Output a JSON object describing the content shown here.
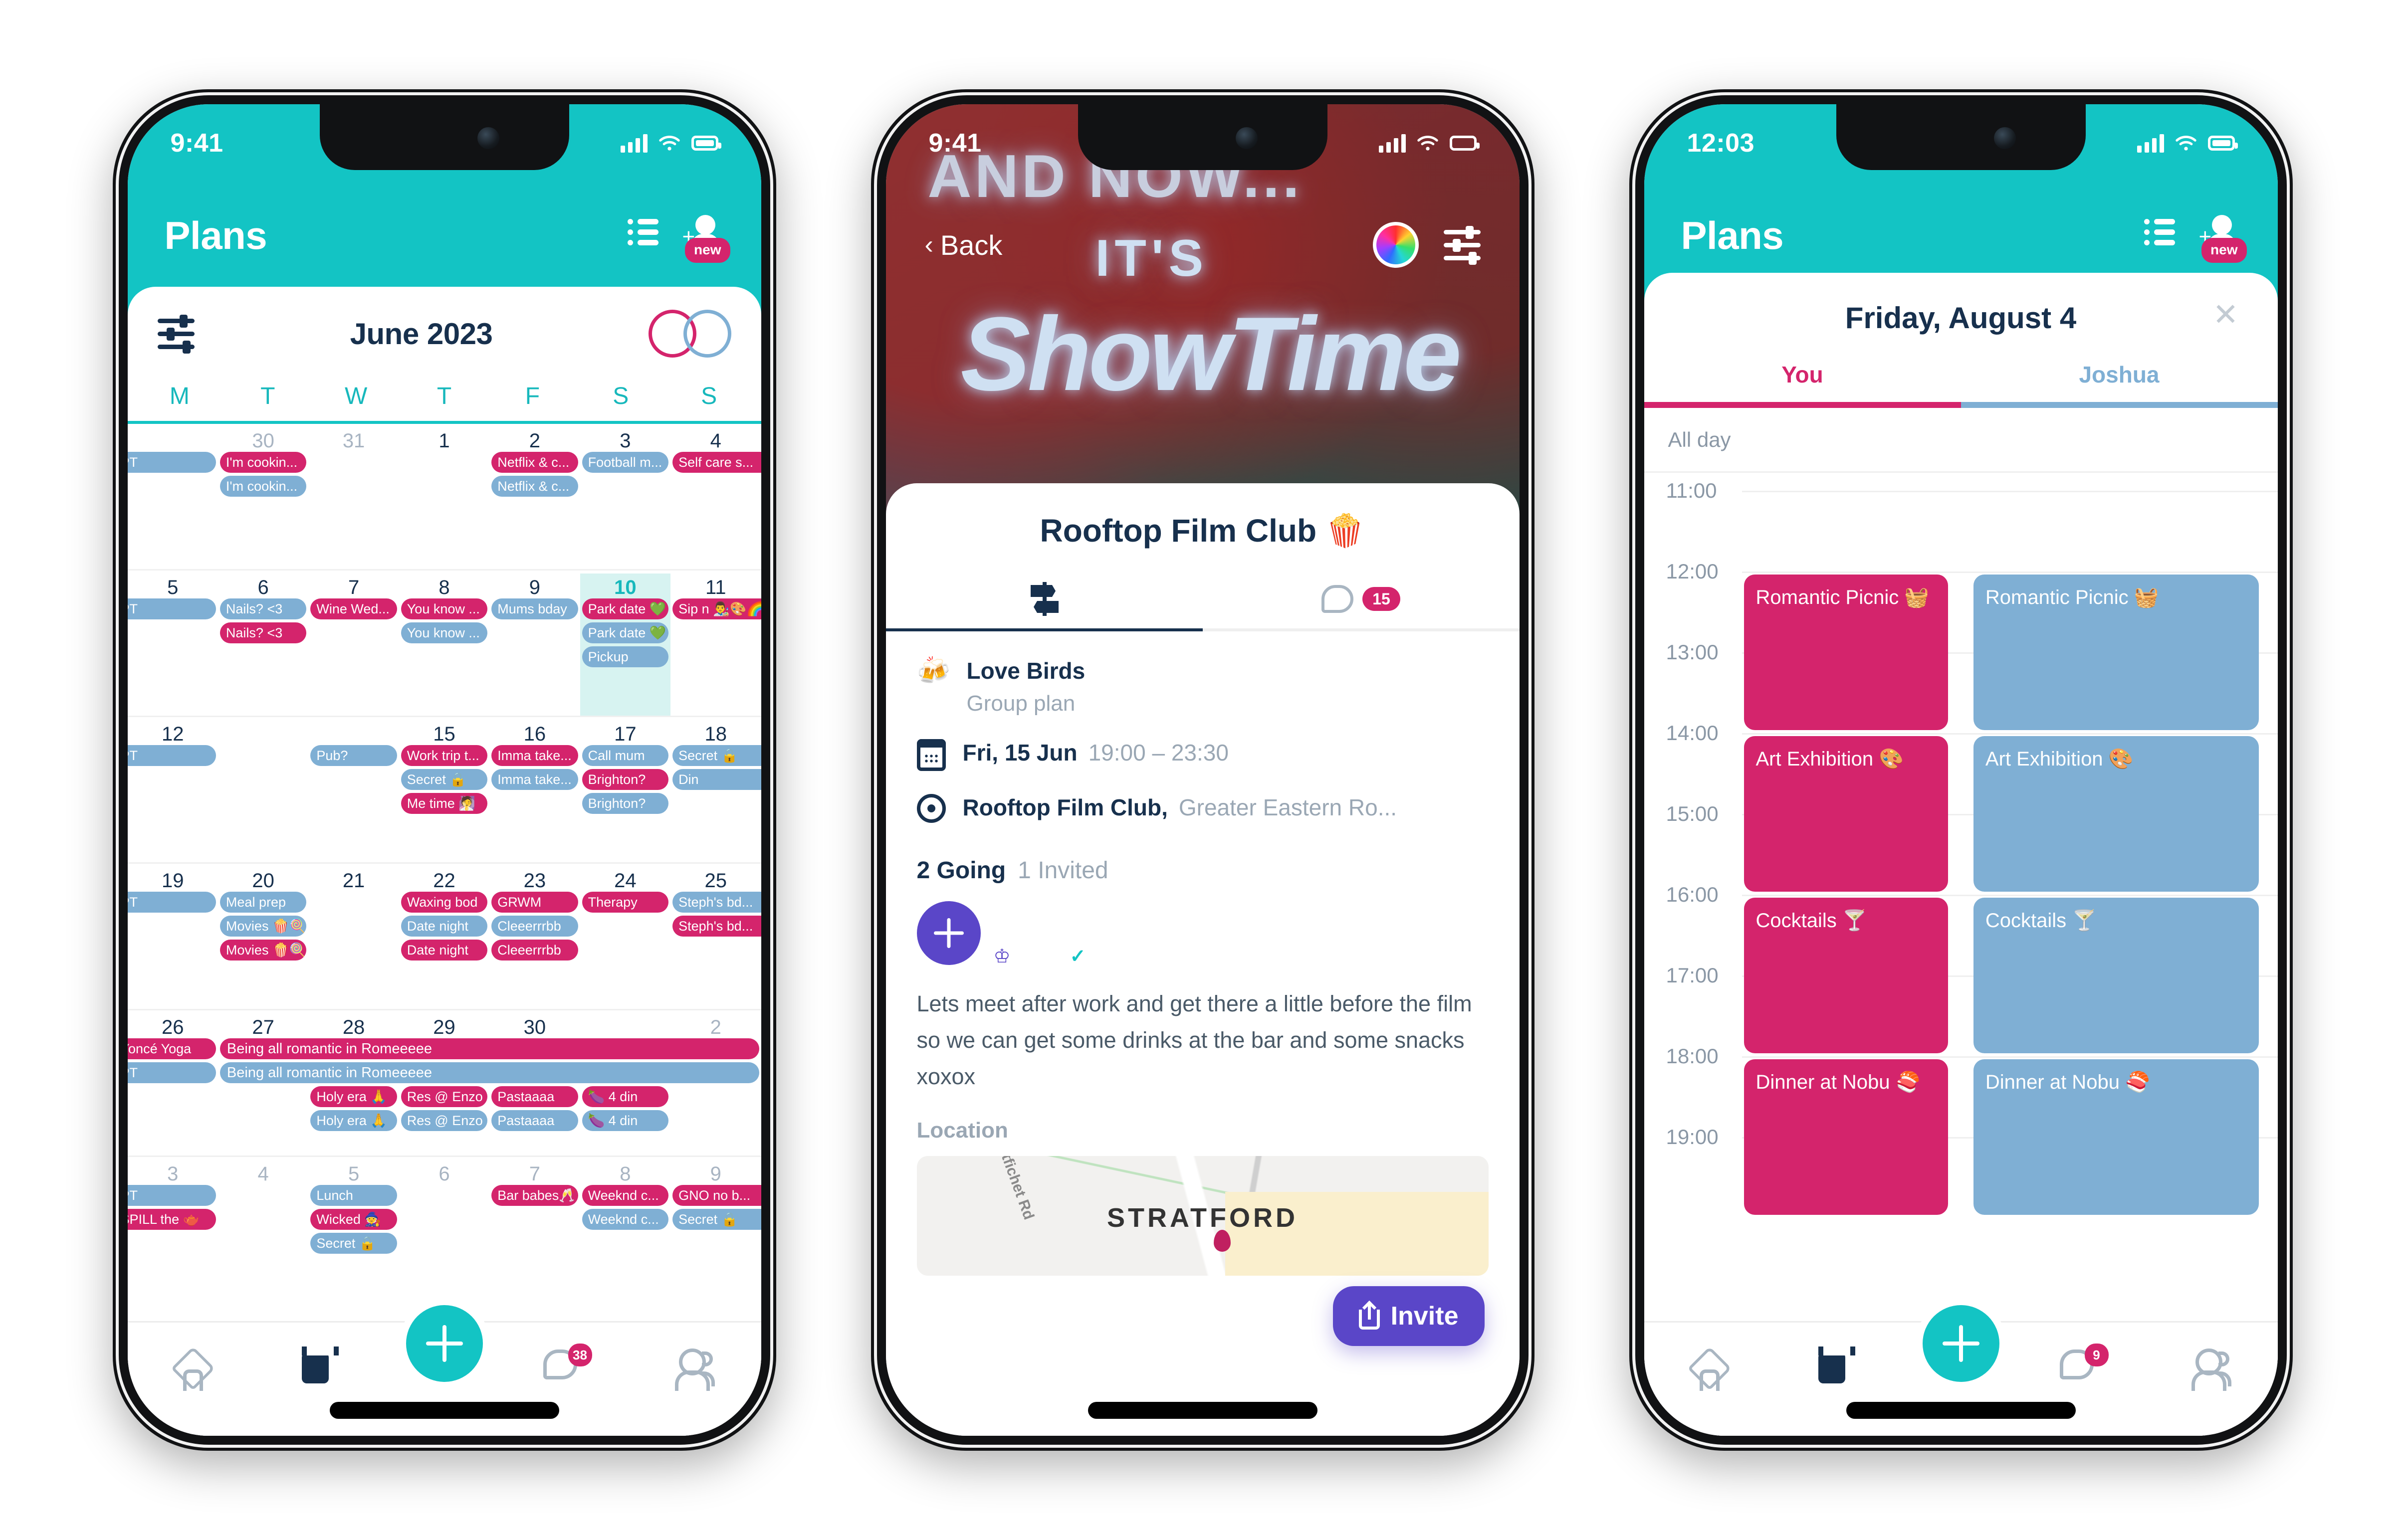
{
  "phone1": {
    "status": {
      "time": "9:41",
      "signal_icon": "cellular-bars-icon",
      "wifi_icon": "wifi-icon",
      "battery_icon": "battery-icon"
    },
    "header": {
      "title": "Plans",
      "list_icon": "list-view-icon",
      "add_user_icon": "add-user-icon",
      "new_badge": "new"
    },
    "calendar": {
      "filter_icon": "filter-sliders-icon",
      "month": "June 2023",
      "avatar1": "avatar-user-pink",
      "avatar2": "avatar-user-blue",
      "dow": [
        "M",
        "T",
        "W",
        "T",
        "F",
        "S",
        "S"
      ],
      "weeks": [
        {
          "days": [
            {
              "num": "",
              "dim": false
            },
            {
              "num": "30",
              "dim": true
            },
            {
              "num": "31",
              "dim": true
            },
            {
              "num": "1",
              "dim": false
            },
            {
              "num": "2",
              "dim": false
            },
            {
              "num": "3",
              "dim": false
            },
            {
              "num": "4",
              "dim": false
            }
          ],
          "chips": [
            {
              "col": 0,
              "row": 0,
              "color": "blue",
              "label": "PT",
              "bleedL": true
            },
            {
              "col": 1,
              "row": 0,
              "color": "pink",
              "label": "I'm cookin..."
            },
            {
              "col": 1,
              "row": 1,
              "color": "blue",
              "label": "I'm cookin..."
            },
            {
              "col": 4,
              "row": 0,
              "color": "pink",
              "label": "Netflix & c..."
            },
            {
              "col": 4,
              "row": 1,
              "color": "blue",
              "label": "Netflix & c..."
            },
            {
              "col": 5,
              "row": 0,
              "color": "blue",
              "label": "Football m..."
            },
            {
              "col": 6,
              "row": 0,
              "color": "pink",
              "label": "Self care s...",
              "bleedR": true
            }
          ]
        },
        {
          "days": [
            {
              "num": "5",
              "dim": false
            },
            {
              "num": "6",
              "dim": false
            },
            {
              "num": "7",
              "dim": false
            },
            {
              "num": "8",
              "dim": false
            },
            {
              "num": "9",
              "dim": false
            },
            {
              "num": "10",
              "dim": false,
              "today": true
            },
            {
              "num": "11",
              "dim": false
            }
          ],
          "chips": [
            {
              "col": 0,
              "row": 0,
              "color": "blue",
              "label": "PT",
              "bleedL": true
            },
            {
              "col": 1,
              "row": 0,
              "color": "blue",
              "label": "Nails? <3"
            },
            {
              "col": 1,
              "row": 1,
              "color": "pink",
              "label": "Nails? <3"
            },
            {
              "col": 2,
              "row": 0,
              "color": "pink",
              "label": "Wine Wed..."
            },
            {
              "col": 3,
              "row": 0,
              "color": "pink",
              "label": "You know ..."
            },
            {
              "col": 3,
              "row": 1,
              "color": "blue",
              "label": "You know ..."
            },
            {
              "col": 4,
              "row": 0,
              "color": "blue",
              "label": "Mums bday"
            },
            {
              "col": 5,
              "row": 0,
              "color": "pink",
              "label": "Park date 💚"
            },
            {
              "col": 5,
              "row": 1,
              "color": "blue",
              "label": "Park date 💚"
            },
            {
              "col": 5,
              "row": 2,
              "color": "blue",
              "label": "Pickup"
            },
            {
              "col": 6,
              "row": 0,
              "color": "pink",
              "label": "Sip n 👨‍🎨🎨🌈",
              "bleedR": true
            }
          ]
        },
        {
          "days": [
            {
              "num": "12",
              "dim": false
            },
            {
              "num": "",
              "dim": false
            },
            {
              "num": "",
              "dim": false
            },
            {
              "num": "15",
              "dim": false
            },
            {
              "num": "16",
              "dim": false
            },
            {
              "num": "17",
              "dim": false
            },
            {
              "num": "18",
              "dim": false
            }
          ],
          "chips": [
            {
              "col": 0,
              "row": 0,
              "color": "blue",
              "label": "PT",
              "bleedL": true
            },
            {
              "col": 2,
              "row": 0,
              "color": "blue",
              "label": "Pub?"
            },
            {
              "col": 3,
              "row": 0,
              "color": "pink",
              "label": "Work trip t..."
            },
            {
              "col": 3,
              "row": 1,
              "color": "blue",
              "label": "Secret 🔒"
            },
            {
              "col": 3,
              "row": 2,
              "color": "pink",
              "label": "Me time 🧖"
            },
            {
              "col": 4,
              "row": 0,
              "color": "pink",
              "label": "Imma take..."
            },
            {
              "col": 4,
              "row": 1,
              "color": "blue",
              "label": "Imma take..."
            },
            {
              "col": 5,
              "row": 0,
              "color": "blue",
              "label": "Call mum"
            },
            {
              "col": 5,
              "row": 1,
              "color": "pink",
              "label": "Brighton?"
            },
            {
              "col": 5,
              "row": 2,
              "color": "blue",
              "label": "Brighton?"
            },
            {
              "col": 6,
              "row": 0,
              "color": "blue",
              "label": "Secret 🔒",
              "bleedR": true
            },
            {
              "col": 6,
              "row": 1,
              "color": "blue",
              "label": "Din",
              "bleedR": true
            }
          ]
        },
        {
          "days": [
            {
              "num": "19",
              "dim": false
            },
            {
              "num": "20",
              "dim": false
            },
            {
              "num": "21",
              "dim": false
            },
            {
              "num": "22",
              "dim": false
            },
            {
              "num": "23",
              "dim": false
            },
            {
              "num": "24",
              "dim": false
            },
            {
              "num": "25",
              "dim": false
            }
          ],
          "chips": [
            {
              "col": 0,
              "row": 0,
              "color": "blue",
              "label": "PT",
              "bleedL": true
            },
            {
              "col": 1,
              "row": 0,
              "color": "blue",
              "label": "Meal prep"
            },
            {
              "col": 1,
              "row": 1,
              "color": "blue",
              "label": "Movies 🍿🍭"
            },
            {
              "col": 1,
              "row": 2,
              "color": "pink",
              "label": "Movies 🍿🍭"
            },
            {
              "col": 3,
              "row": 0,
              "color": "pink",
              "label": "Waxing bod"
            },
            {
              "col": 3,
              "row": 1,
              "color": "blue",
              "label": "Date night"
            },
            {
              "col": 3,
              "row": 2,
              "color": "pink",
              "label": "Date night"
            },
            {
              "col": 4,
              "row": 0,
              "color": "pink",
              "label": "GRWM"
            },
            {
              "col": 4,
              "row": 1,
              "color": "blue",
              "label": "Cleeerrrbb"
            },
            {
              "col": 4,
              "row": 2,
              "color": "pink",
              "label": "Cleeerrrbb"
            },
            {
              "col": 5,
              "row": 0,
              "color": "pink",
              "label": "Therapy"
            },
            {
              "col": 6,
              "row": 0,
              "color": "blue",
              "label": "Steph's bd...",
              "bleedR": true
            },
            {
              "col": 6,
              "row": 1,
              "color": "pink",
              "label": "Steph's bd...",
              "bleedR": true
            }
          ]
        },
        {
          "days": [
            {
              "num": "26",
              "dim": false
            },
            {
              "num": "27",
              "dim": false
            },
            {
              "num": "28",
              "dim": false
            },
            {
              "num": "29",
              "dim": false
            },
            {
              "num": "30",
              "dim": false
            },
            {
              "num": "",
              "dim": true
            },
            {
              "num": "2",
              "dim": true
            }
          ],
          "chips": [
            {
              "col": 0,
              "row": 0,
              "color": "pink",
              "label": "Yoncé Yoga",
              "bleedL": true
            },
            {
              "col": 0,
              "row": 1,
              "color": "blue",
              "label": "PT",
              "bleedL": true
            },
            {
              "col": 2,
              "row": 2,
              "color": "pink",
              "label": "Holy era 🙏"
            },
            {
              "col": 2,
              "row": 3,
              "color": "blue",
              "label": "Holy era 🙏"
            },
            {
              "col": 3,
              "row": 2,
              "color": "pink",
              "label": "Res @ Enzo"
            },
            {
              "col": 3,
              "row": 3,
              "color": "blue",
              "label": "Res @ Enzo"
            },
            {
              "col": 4,
              "row": 2,
              "color": "pink",
              "label": "Pastaaaa"
            },
            {
              "col": 4,
              "row": 3,
              "color": "blue",
              "label": "Pastaaaa"
            },
            {
              "col": 5,
              "row": 2,
              "color": "pink",
              "label": "🍆 4 din"
            },
            {
              "col": 5,
              "row": 3,
              "color": "blue",
              "label": "🍆 4 din"
            }
          ],
          "spans": [
            {
              "start": 1,
              "end": 6,
              "row": 0,
              "color": "pink",
              "label": "Being all romantic in Romeeeee"
            },
            {
              "start": 1,
              "end": 6,
              "row": 1,
              "color": "blue",
              "label": "Being all romantic in Romeeeee"
            }
          ]
        },
        {
          "days": [
            {
              "num": "3",
              "dim": true
            },
            {
              "num": "4",
              "dim": true
            },
            {
              "num": "5",
              "dim": true
            },
            {
              "num": "6",
              "dim": true
            },
            {
              "num": "7",
              "dim": true
            },
            {
              "num": "8",
              "dim": true
            },
            {
              "num": "9",
              "dim": true
            }
          ],
          "chips": [
            {
              "col": 0,
              "row": 0,
              "color": "blue",
              "label": "PT",
              "bleedL": true
            },
            {
              "col": 0,
              "row": 1,
              "color": "pink",
              "label": "SPILL the 🫖",
              "bleedL": true
            },
            {
              "col": 2,
              "row": 0,
              "color": "blue",
              "label": "Lunch"
            },
            {
              "col": 2,
              "row": 1,
              "color": "pink",
              "label": "Wicked 🧙"
            },
            {
              "col": 2,
              "row": 2,
              "color": "blue",
              "label": "Secret 🔒"
            },
            {
              "col": 4,
              "row": 0,
              "color": "pink",
              "label": "Bar babes🥂"
            },
            {
              "col": 5,
              "row": 0,
              "color": "pink",
              "label": "Weeknd c..."
            },
            {
              "col": 5,
              "row": 1,
              "color": "blue",
              "label": "Weeknd c..."
            },
            {
              "col": 6,
              "row": 0,
              "color": "pink",
              "label": "GNO no b...",
              "bleedR": true
            },
            {
              "col": 6,
              "row": 1,
              "color": "blue",
              "label": "Secret 🔒",
              "bleedR": true
            }
          ]
        }
      ]
    },
    "nav": {
      "home_icon": "home-icon",
      "calendar_icon": "calendar-icon",
      "add_icon": "plus-icon",
      "chat_icon": "chat-icon",
      "chat_badge": "38",
      "people_icon": "people-icon"
    }
  },
  "phone2": {
    "status": {
      "time": "9:41"
    },
    "hero": {
      "sign_line1": "AND NOW...",
      "sign_line2": "IT'S",
      "sign_line3": "ShowTime",
      "back_label": "Back",
      "color_wheel_icon": "color-wheel-icon",
      "settings_icon": "settings-sliders-icon"
    },
    "sheet": {
      "title": "Rooftop Film Club 🍿",
      "tab_details_icon": "signpost-icon",
      "tab_chat_icon": "chat-bubble-icon",
      "chat_count": "15",
      "group": {
        "emoji": "🍻",
        "name": "Love Birds",
        "subtitle": "Group plan"
      },
      "date": {
        "icon": "calendar-icon",
        "day": "Fri, 15 Jun",
        "time": "19:00 – 23:30"
      },
      "place": {
        "icon": "location-pin-icon",
        "venue": "Rooftop Film Club,",
        "address": "Greater Eastern Ro..."
      },
      "going_label": "2 Going",
      "invited_label": "1 Invited",
      "add_person_icon": "plus-icon",
      "avatar_host": "avatar-host",
      "avatar_guest": "avatar-guest",
      "host_marker": "♔",
      "guest_marker": "✓",
      "description": "Lets meet after work and get there a little before the film so we can get some drinks at the bar and some snacks xoxox",
      "location_label": "Location",
      "map_road": "ntfichet Rd",
      "map_town": "STRATFORD",
      "map_pin_icon": "map-pin-icon",
      "invite_label": "Invite",
      "invite_icon": "share-icon"
    }
  },
  "phone3": {
    "status": {
      "time": "12:03"
    },
    "header": {
      "title": "Plans",
      "list_icon": "list-view-icon",
      "add_user_icon": "add-user-icon",
      "new_badge": "new"
    },
    "day": {
      "title": "Friday, August 4",
      "close_icon": "close-icon",
      "tab_you": "You",
      "tab_other": "Joshua",
      "all_day_label": "All day",
      "hours": [
        "11:00",
        "12:00",
        "13:00",
        "14:00",
        "15:00",
        "16:00",
        "17:00",
        "18:00",
        "19:00"
      ],
      "events_you": [
        {
          "label": "Romantic Picnic 🧺",
          "start": 12.0,
          "end": 14.0
        },
        {
          "label": "Art Exhibition 🎨",
          "start": 14.0,
          "end": 16.0
        },
        {
          "label": "Cocktails 🍸",
          "start": 16.0,
          "end": 18.0
        },
        {
          "label": "Dinner at Nobu 🍣",
          "start": 18.0,
          "end": 20.0
        }
      ],
      "events_other": [
        {
          "label": "Romantic Picnic 🧺",
          "start": 12.0,
          "end": 14.0
        },
        {
          "label": "Art Exhibition 🎨",
          "start": 14.0,
          "end": 16.0
        },
        {
          "label": "Cocktails 🍸",
          "start": 16.0,
          "end": 18.0
        },
        {
          "label": "Dinner at Nobu 🍣",
          "start": 18.0,
          "end": 20.0
        }
      ]
    },
    "nav": {
      "chat_badge": "9"
    }
  },
  "colors": {
    "teal": "#13C4C4",
    "pink": "#D4246C",
    "blue": "#7FAFD4",
    "navy": "#17304D",
    "purple": "#5A46C8",
    "today_bg": "#D7F3F1"
  }
}
